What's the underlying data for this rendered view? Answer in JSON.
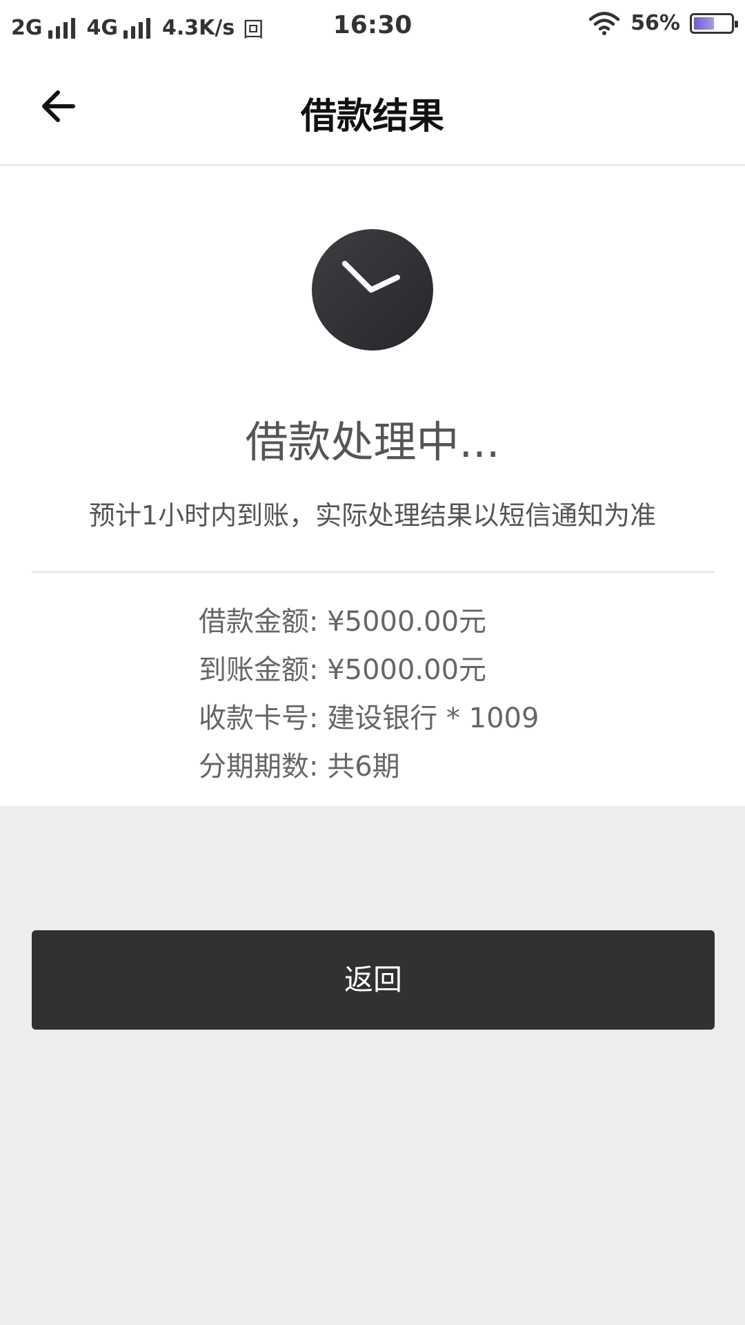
{
  "status_bar": {
    "sim1_label": "2G",
    "sim2_label": "4G",
    "net_speed": "4.3K/s",
    "notification_glyph": "回",
    "time": "16:30",
    "battery_text": "56%",
    "battery_level": 0.56,
    "battery_color": "#7a6ae0"
  },
  "nav": {
    "back_icon": "arrow-left-icon",
    "title": "借款结果"
  },
  "result": {
    "status_icon": "clock-icon",
    "title": "借款处理中...",
    "hint": "预计1小时内到账，实际处理结果以短信通知为准"
  },
  "details": {
    "loan_amount": "借款金额: ¥5000.00元",
    "received_amount": "到账金额: ¥5000.00元",
    "card_number": "收款卡号: 建设银行 * 1009",
    "installments": "分期期数: 共6期"
  },
  "actions": {
    "return_label": "返回"
  },
  "colors": {
    "button_bg": "#303230",
    "page_bg": "#eceeee",
    "text_gray": "#555555"
  }
}
